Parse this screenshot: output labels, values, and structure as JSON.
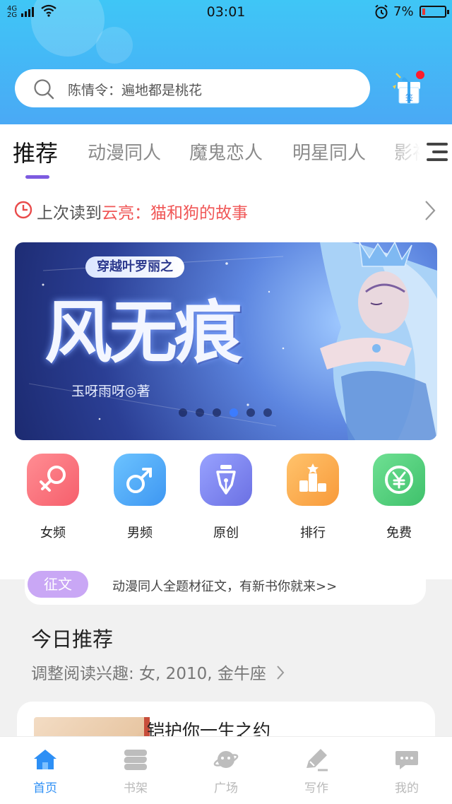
{
  "status_bar": {
    "network_top": "4G",
    "network_bottom": "2G",
    "time": "03:01",
    "battery_percent": "7%"
  },
  "search": {
    "placeholder": "陈情令：遍地都是桃花"
  },
  "sign_in": {
    "label": "签"
  },
  "tabs": [
    {
      "label": "推荐",
      "active": true
    },
    {
      "label": "动漫同人"
    },
    {
      "label": "魔鬼恋人"
    },
    {
      "label": "明星同人"
    },
    {
      "label": "影视"
    }
  ],
  "last_read": {
    "prefix": "上次读到",
    "book": "云亮：猫和狗的故事"
  },
  "banner": {
    "subtitle": "穿越叶罗丽之",
    "title": "风无痕",
    "author": "玉呀雨呀◎著",
    "dot_count": 6,
    "active_dot": 4
  },
  "quick_entries": [
    {
      "label": "女频",
      "icon": "female-icon",
      "color": "#f76f78"
    },
    {
      "label": "男频",
      "icon": "male-icon",
      "color": "#4aa6f5"
    },
    {
      "label": "原创",
      "icon": "pen-nib-icon",
      "color": "#7a82ef"
    },
    {
      "label": "排行",
      "icon": "podium-icon",
      "color": "#f9a64a"
    },
    {
      "label": "免费",
      "icon": "yen-icon",
      "color": "#4fcf7b"
    }
  ],
  "essay": {
    "tag": "征文",
    "text": "动漫同人全题材征文，有新书你就来>>"
  },
  "today": {
    "heading": "今日推荐",
    "interest": "调整阅读兴趣: 女, 2010, 金牛座"
  },
  "featured_book": {
    "title": "铠护你一生之约"
  },
  "bottom_nav": [
    {
      "label": "首页",
      "icon": "home-icon",
      "active": true
    },
    {
      "label": "书架",
      "icon": "bookshelf-icon"
    },
    {
      "label": "广场",
      "icon": "planet-icon"
    },
    {
      "label": "写作",
      "icon": "pen-icon"
    },
    {
      "label": "我的",
      "icon": "chat-bubble-icon"
    }
  ],
  "colors": {
    "header_start": "#3fc6f6",
    "header_end": "#4aa9f5",
    "tab_indicator": "#7d5be0",
    "last_read_book": "#f05757",
    "nav_active": "#2d8ff5",
    "essay_tag": "#c9a7f5"
  }
}
